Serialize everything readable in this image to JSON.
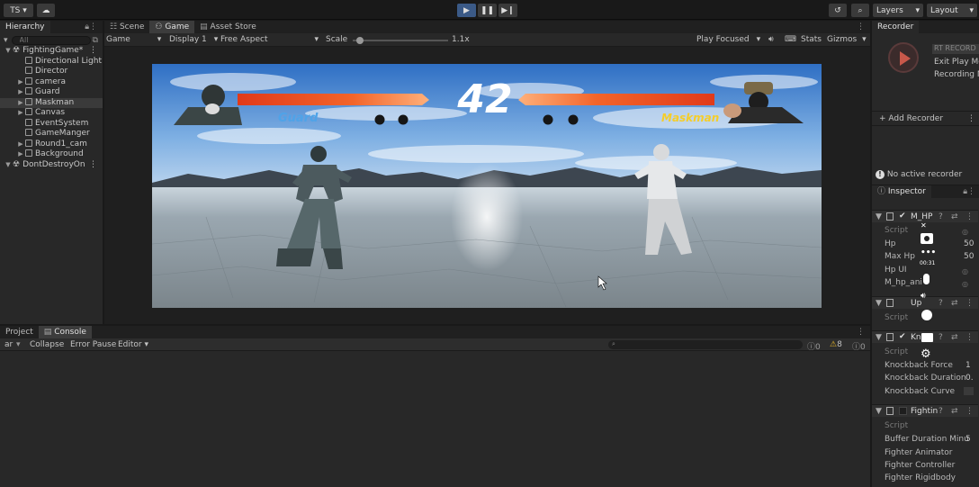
{
  "toolbar": {
    "account": "TS",
    "layers": "Layers",
    "layout": "Layout"
  },
  "hierarchy": {
    "title": "Hierarchy",
    "search_placeholder": "All",
    "items": [
      {
        "label": "FightingGame*",
        "type": "scene"
      },
      {
        "label": "Directional Light",
        "type": "go"
      },
      {
        "label": "Director",
        "type": "go"
      },
      {
        "label": "camera",
        "type": "go",
        "caret": true
      },
      {
        "label": "Guard",
        "type": "go",
        "caret": true
      },
      {
        "label": "Maskman",
        "type": "go",
        "caret": true,
        "selected": true
      },
      {
        "label": "Canvas",
        "type": "go",
        "caret": true
      },
      {
        "label": "EventSystem",
        "type": "go"
      },
      {
        "label": "GameManger",
        "type": "go"
      },
      {
        "label": "Round1_cam",
        "type": "go",
        "caret": true
      },
      {
        "label": "Background",
        "type": "go",
        "caret": true
      },
      {
        "label": "DontDestroyOn",
        "type": "scene"
      }
    ]
  },
  "center_tabs": [
    "Scene",
    "Game",
    "Asset Store"
  ],
  "game_toolbar": {
    "mode": "Game",
    "display": "Display 1",
    "aspect": "Free Aspect",
    "scale_label": "Scale",
    "scale_value": "1.1x",
    "play_focused": "Play Focused",
    "stats": "Stats",
    "gizmos": "Gizmos"
  },
  "game_view": {
    "timer": "42",
    "player1_name": "Guard",
    "player2_name": "Maskman",
    "player1_health": 0.98,
    "player2_health": 0.98
  },
  "bottom": {
    "tabs": [
      "Project",
      "Console"
    ],
    "clear": "ar",
    "collapse": "Collapse",
    "error_pause": "Error Pause",
    "editor": "Editor",
    "count_log": "0",
    "count_warn": "8",
    "count_err": "0"
  },
  "recorder": {
    "title": "Recorder",
    "record_label": "RT RECORD",
    "exit_play": "Exit Play Mo",
    "recording_mode": "Recording M",
    "add_recorder": "+ Add Recorder",
    "no_active": "No active recorder"
  },
  "inspector": {
    "title": "Inspector",
    "comp1": {
      "name": "M_HP",
      "script_label": "Script",
      "fields": [
        {
          "label": "Hp",
          "value": "50"
        },
        {
          "label": "Max Hp",
          "value": "50"
        },
        {
          "label": "Hp UI",
          "value": ""
        },
        {
          "label": "M_hp_ani",
          "value": ""
        }
      ]
    },
    "comp2": {
      "name": "Up",
      "script_label": "Script"
    },
    "comp3": {
      "name": "Kn",
      "script_label": "Script",
      "fields": [
        {
          "label": "Knockback Force",
          "value": "1"
        },
        {
          "label": "Knockback Duration",
          "value": "0."
        },
        {
          "label": "Knockback Curve",
          "value": ""
        }
      ]
    },
    "comp4": {
      "name": "Fightin",
      "script_label": "Script",
      "fields": [
        {
          "label": "Buffer Duration Minu",
          "value": "5"
        },
        {
          "label": "Fighter Animator",
          "value": ""
        },
        {
          "label": "Fighter Controller",
          "value": ""
        },
        {
          "label": "Fighter Rigidbody",
          "value": ""
        }
      ]
    }
  },
  "overlay": {
    "time": "00:31"
  }
}
